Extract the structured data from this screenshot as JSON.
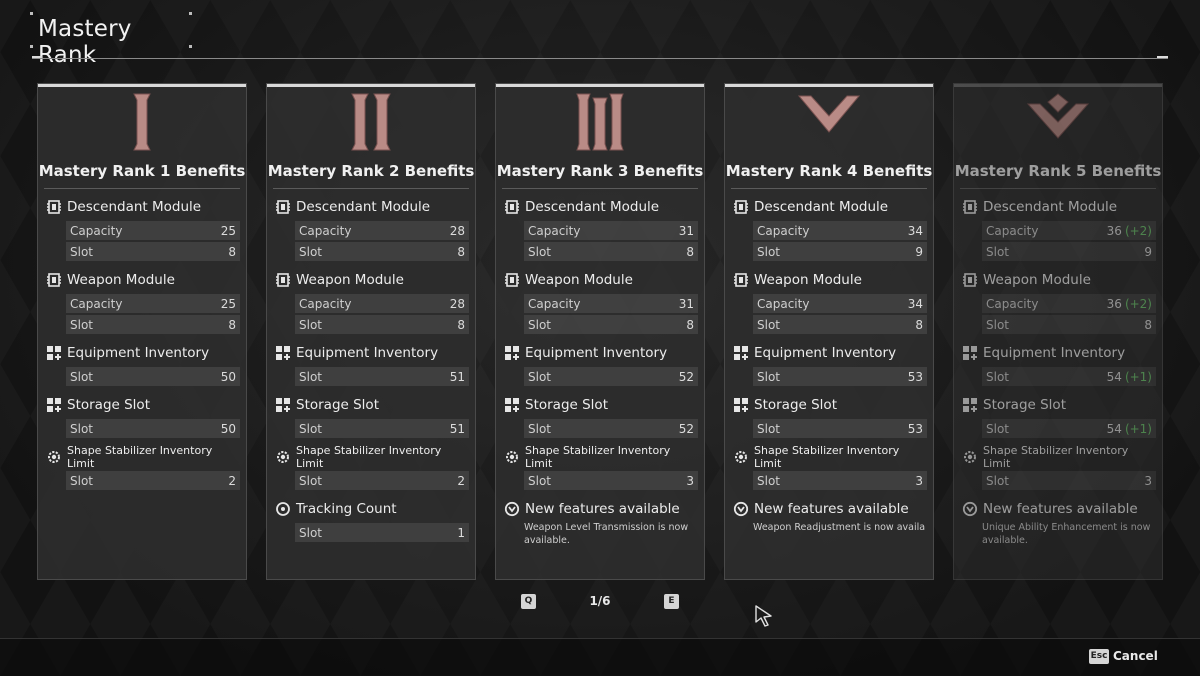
{
  "header": {
    "title": "Mastery Rank"
  },
  "cards": [
    {
      "title": "Mastery Rank 1 Benefits",
      "rank_icon": "rank-1-icon",
      "sections": [
        {
          "label": "Descendant Module",
          "icon": "module-chip-icon",
          "rows": [
            {
              "label": "Capacity",
              "value": "25",
              "bonus": ""
            },
            {
              "label": "Slot",
              "value": "8",
              "bonus": ""
            }
          ]
        },
        {
          "label": "Weapon Module",
          "icon": "module-chip-icon",
          "rows": [
            {
              "label": "Capacity",
              "value": "25",
              "bonus": ""
            },
            {
              "label": "Slot",
              "value": "8",
              "bonus": ""
            }
          ]
        },
        {
          "label": "Equipment Inventory",
          "icon": "inventory-grid-icon",
          "rows": [
            {
              "label": "Slot",
              "value": "50",
              "bonus": ""
            }
          ]
        },
        {
          "label": "Storage Slot",
          "icon": "inventory-grid-icon",
          "rows": [
            {
              "label": "Slot",
              "value": "50",
              "bonus": ""
            }
          ]
        },
        {
          "label": "Shape Stabilizer Inventory Limit",
          "icon": "gear-shape-icon",
          "rows": [
            {
              "label": "Slot",
              "value": "2",
              "bonus": ""
            }
          ]
        }
      ]
    },
    {
      "title": "Mastery Rank 2 Benefits",
      "rank_icon": "rank-2-icon",
      "sections": [
        {
          "label": "Descendant Module",
          "icon": "module-chip-icon",
          "rows": [
            {
              "label": "Capacity",
              "value": "28",
              "bonus": ""
            },
            {
              "label": "Slot",
              "value": "8",
              "bonus": ""
            }
          ]
        },
        {
          "label": "Weapon Module",
          "icon": "module-chip-icon",
          "rows": [
            {
              "label": "Capacity",
              "value": "28",
              "bonus": ""
            },
            {
              "label": "Slot",
              "value": "8",
              "bonus": ""
            }
          ]
        },
        {
          "label": "Equipment Inventory",
          "icon": "inventory-grid-icon",
          "rows": [
            {
              "label": "Slot",
              "value": "51",
              "bonus": ""
            }
          ]
        },
        {
          "label": "Storage Slot",
          "icon": "inventory-grid-icon",
          "rows": [
            {
              "label": "Slot",
              "value": "51",
              "bonus": ""
            }
          ]
        },
        {
          "label": "Shape Stabilizer Inventory Limit",
          "icon": "gear-shape-icon",
          "rows": [
            {
              "label": "Slot",
              "value": "2",
              "bonus": ""
            }
          ]
        },
        {
          "label": "Tracking Count",
          "icon": "tracking-target-icon",
          "rows": [
            {
              "label": "Slot",
              "value": "1",
              "bonus": ""
            }
          ]
        }
      ]
    },
    {
      "title": "Mastery Rank 3 Benefits",
      "rank_icon": "rank-3-icon",
      "sections": [
        {
          "label": "Descendant Module",
          "icon": "module-chip-icon",
          "rows": [
            {
              "label": "Capacity",
              "value": "31",
              "bonus": ""
            },
            {
              "label": "Slot",
              "value": "8",
              "bonus": ""
            }
          ]
        },
        {
          "label": "Weapon Module",
          "icon": "module-chip-icon",
          "rows": [
            {
              "label": "Capacity",
              "value": "31",
              "bonus": ""
            },
            {
              "label": "Slot",
              "value": "8",
              "bonus": ""
            }
          ]
        },
        {
          "label": "Equipment Inventory",
          "icon": "inventory-grid-icon",
          "rows": [
            {
              "label": "Slot",
              "value": "52",
              "bonus": ""
            }
          ]
        },
        {
          "label": "Storage Slot",
          "icon": "inventory-grid-icon",
          "rows": [
            {
              "label": "Slot",
              "value": "52",
              "bonus": ""
            }
          ]
        },
        {
          "label": "Shape Stabilizer Inventory Limit",
          "icon": "gear-shape-icon",
          "rows": [
            {
              "label": "Slot",
              "value": "3",
              "bonus": ""
            }
          ]
        },
        {
          "label": "New features available",
          "icon": "new-feature-icon",
          "rows": [],
          "note": "Weapon Level Transmission is now available."
        }
      ]
    },
    {
      "title": "Mastery Rank 4 Benefits",
      "rank_icon": "rank-4-icon",
      "sections": [
        {
          "label": "Descendant Module",
          "icon": "module-chip-icon",
          "rows": [
            {
              "label": "Capacity",
              "value": "34",
              "bonus": ""
            },
            {
              "label": "Slot",
              "value": "9",
              "bonus": ""
            }
          ]
        },
        {
          "label": "Weapon Module",
          "icon": "module-chip-icon",
          "rows": [
            {
              "label": "Capacity",
              "value": "34",
              "bonus": ""
            },
            {
              "label": "Slot",
              "value": "8",
              "bonus": ""
            }
          ]
        },
        {
          "label": "Equipment Inventory",
          "icon": "inventory-grid-icon",
          "rows": [
            {
              "label": "Slot",
              "value": "53",
              "bonus": ""
            }
          ]
        },
        {
          "label": "Storage Slot",
          "icon": "inventory-grid-icon",
          "rows": [
            {
              "label": "Slot",
              "value": "53",
              "bonus": ""
            }
          ]
        },
        {
          "label": "Shape Stabilizer Inventory Limit",
          "icon": "gear-shape-icon",
          "rows": [
            {
              "label": "Slot",
              "value": "3",
              "bonus": ""
            }
          ]
        },
        {
          "label": "New features available",
          "icon": "new-feature-icon",
          "rows": [],
          "note": "Weapon Readjustment is now availa"
        }
      ]
    },
    {
      "title": "Mastery Rank 5 Benefits",
      "rank_icon": "rank-5-icon",
      "dim": true,
      "sections": [
        {
          "label": "Descendant Module",
          "icon": "module-chip-icon",
          "rows": [
            {
              "label": "Capacity",
              "value": "36",
              "bonus": "(+2)"
            },
            {
              "label": "Slot",
              "value": "9",
              "bonus": ""
            }
          ]
        },
        {
          "label": "Weapon Module",
          "icon": "module-chip-icon",
          "rows": [
            {
              "label": "Capacity",
              "value": "36",
              "bonus": "(+2)"
            },
            {
              "label": "Slot",
              "value": "8",
              "bonus": ""
            }
          ]
        },
        {
          "label": "Equipment Inventory",
          "icon": "inventory-grid-icon",
          "rows": [
            {
              "label": "Slot",
              "value": "54",
              "bonus": "(+1)"
            }
          ]
        },
        {
          "label": "Storage Slot",
          "icon": "inventory-grid-icon",
          "rows": [
            {
              "label": "Slot",
              "value": "54",
              "bonus": "(+1)"
            }
          ]
        },
        {
          "label": "Shape Stabilizer Inventory Limit",
          "icon": "gear-shape-icon",
          "rows": [
            {
              "label": "Slot",
              "value": "3",
              "bonus": ""
            }
          ]
        },
        {
          "label": "New features available",
          "icon": "new-feature-icon",
          "rows": [],
          "note": "Unique Ability Enhancement is now available."
        }
      ]
    }
  ],
  "pager": {
    "prev_key": "Q",
    "next_key": "E",
    "page": "1/6"
  },
  "footer": {
    "esc_key": "Esc",
    "cancel_label": "Cancel"
  },
  "colors": {
    "rank_icon": "#b98b86",
    "bonus": "#6cc46c",
    "card_bg": "#2e2e2e"
  }
}
